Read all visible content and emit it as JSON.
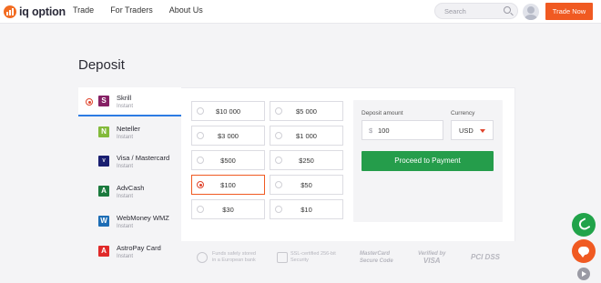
{
  "brand": {
    "logo_text": "iq option",
    "accent": "#f05a22"
  },
  "nav": {
    "items": [
      "Trade",
      "For Traders",
      "About Us"
    ]
  },
  "search": {
    "placeholder": "Search"
  },
  "header": {
    "trade_now": "Trade Now"
  },
  "page": {
    "title": "Deposit"
  },
  "methods": [
    {
      "name": "Skrill",
      "sub": "Instant",
      "selected": true,
      "logo": "S",
      "color": "#862165"
    },
    {
      "name": "Neteller",
      "sub": "Instant",
      "selected": false,
      "logo": "N",
      "color": "#83ba3b"
    },
    {
      "name": "Visa / Mastercard",
      "sub": "Instant",
      "selected": false,
      "logo": "V",
      "color": "#1a1f71"
    },
    {
      "name": "AdvCash",
      "sub": "Instant",
      "selected": false,
      "logo": "A",
      "color": "#1b7a3e"
    },
    {
      "name": "WebMoney WMZ",
      "sub": "Instant",
      "selected": false,
      "logo": "W",
      "color": "#1d6db5"
    },
    {
      "name": "AstroPay Card",
      "sub": "Instant",
      "selected": false,
      "logo": "A",
      "color": "#e02a2a"
    }
  ],
  "amounts": [
    {
      "label": "$10 000",
      "selected": false
    },
    {
      "label": "$5 000",
      "selected": false
    },
    {
      "label": "$3 000",
      "selected": false
    },
    {
      "label": "$1 000",
      "selected": false
    },
    {
      "label": "$500",
      "selected": false
    },
    {
      "label": "$250",
      "selected": false
    },
    {
      "label": "$100",
      "selected": true
    },
    {
      "label": "$50",
      "selected": false
    },
    {
      "label": "$30",
      "selected": false
    },
    {
      "label": "$10",
      "selected": false
    }
  ],
  "form": {
    "amount_label": "Deposit amount",
    "currency_symbol": "$",
    "amount_value": "100",
    "currency_label": "Currency",
    "currency_value": "USD",
    "proceed_label": "Proceed to Payment"
  },
  "footer": {
    "funds_line1": "Funds safely stored",
    "funds_line2": "in a European bank",
    "ssl_line1": "SSL-certified 256-bit",
    "ssl_line2": "Security",
    "mastercard_line1": "MasterCard",
    "mastercard_line2": "Secure Code",
    "visa_line1": "Verified by",
    "visa_line2": "VISA",
    "pci": "PCI DSS"
  }
}
